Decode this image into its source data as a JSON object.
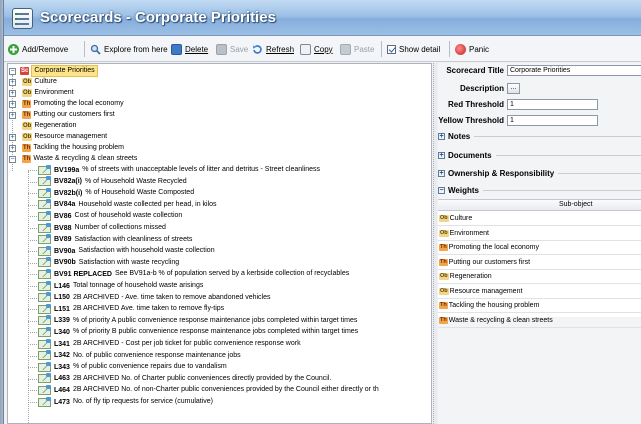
{
  "window": {
    "title": "Scorecards - Corporate Priorities"
  },
  "toolbar": {
    "add_remove": "Add/Remove",
    "explore": "Explore from here",
    "delete": "Delete",
    "save": "Save",
    "refresh": "Refresh",
    "copy": "Copy",
    "paste": "Paste",
    "show_detail": "Show detail",
    "show_detail_checked": true,
    "panic": "Panic"
  },
  "tree": {
    "root": {
      "badge": "Sc",
      "label": "Corporate Priorities"
    },
    "children": [
      {
        "badge": "Ob",
        "label": "Culture"
      },
      {
        "badge": "Ob",
        "label": "Environment"
      },
      {
        "badge": "Th",
        "label": "Promoting the local economy"
      },
      {
        "badge": "Th",
        "label": "Putting our customers first"
      },
      {
        "badge": "Ob",
        "label": "Regeneration"
      },
      {
        "badge": "Ob",
        "label": "Resource management"
      },
      {
        "badge": "Th",
        "label": "Tackling the housing problem"
      },
      {
        "badge": "Th",
        "label": "Waste & recycling & clean streets"
      }
    ],
    "indicators": [
      {
        "code": "BV199a",
        "text": "% of streets with unacceptable levels of litter and detritus - Street cleanliness"
      },
      {
        "code": "BV82a(i)",
        "text": "% of Household Waste Recycled"
      },
      {
        "code": "BV82b(i)",
        "text": "% of Household Waste Composted"
      },
      {
        "code": "BV84a",
        "text": "Household waste collected per head, in kilos"
      },
      {
        "code": "BV86",
        "text": "Cost of household waste collection"
      },
      {
        "code": "BV88",
        "text": "Number of collections missed"
      },
      {
        "code": "BV89",
        "text": "Satisfaction with cleanliness of streets"
      },
      {
        "code": "BV90a",
        "text": "Satisfaction with household waste collection"
      },
      {
        "code": "BV90b",
        "text": "Satisfaction with waste recycling"
      },
      {
        "code": "BV91 REPLACED",
        "text": "See BV91a-b % of population served by a kerbside collection of recyclables"
      },
      {
        "code": "L146",
        "text": "Total tonnage of household waste arisings"
      },
      {
        "code": "L150",
        "text": "2B ARCHIVED - Ave. time taken to remove abandoned vehicles"
      },
      {
        "code": "L151",
        "text": "2B ARCHIVED Ave. time taken to remove fly-tips"
      },
      {
        "code": "L339",
        "text": "% of priority A public convenience response maintenance jobs completed within target times"
      },
      {
        "code": "L340",
        "text": "% of priority B public convenience response maintenance jobs completed within target times"
      },
      {
        "code": "L341",
        "text": "2B ARCHIVED - Cost per job ticket for public convenience response work"
      },
      {
        "code": "L342",
        "text": "No. of public convenience response maintenance jobs"
      },
      {
        "code": "L343",
        "text": "% of public convenience repairs due to vandalism"
      },
      {
        "code": "L463",
        "text": "2B ARCHIVED No. of Charter public conveniences directly provided by the Council."
      },
      {
        "code": "L464",
        "text": "2B ARCHIVED No. of non-Charter public conveniences provided by the Council either directly or th"
      },
      {
        "code": "L473",
        "text": "No. of fly tip requests for service (cumulative)"
      }
    ]
  },
  "details": {
    "title_label": "Scorecard Title",
    "title_value": "Corporate Priorities",
    "description_label": "Description",
    "description_button": "...",
    "red_label": "Red Threshold",
    "red_value": "1",
    "yellow_label": "Yellow Threshold",
    "yellow_value": "1",
    "sections": {
      "notes": "Notes",
      "documents": "Documents",
      "ownership": "Ownership & Responsibility",
      "weights": "Weights"
    },
    "weights_header": "Sub-object",
    "weights_rows": [
      {
        "badge": "Ob",
        "label": "Culture"
      },
      {
        "badge": "Ob",
        "label": "Environment"
      },
      {
        "badge": "Th",
        "label": "Promoting the local economy"
      },
      {
        "badge": "Th",
        "label": "Putting our customers first"
      },
      {
        "badge": "Ob",
        "label": "Regeneration"
      },
      {
        "badge": "Ob",
        "label": "Resource management"
      },
      {
        "badge": "Th",
        "label": "Tackling the housing problem"
      },
      {
        "badge": "Th",
        "label": "Waste & recycling & clean streets"
      }
    ]
  }
}
